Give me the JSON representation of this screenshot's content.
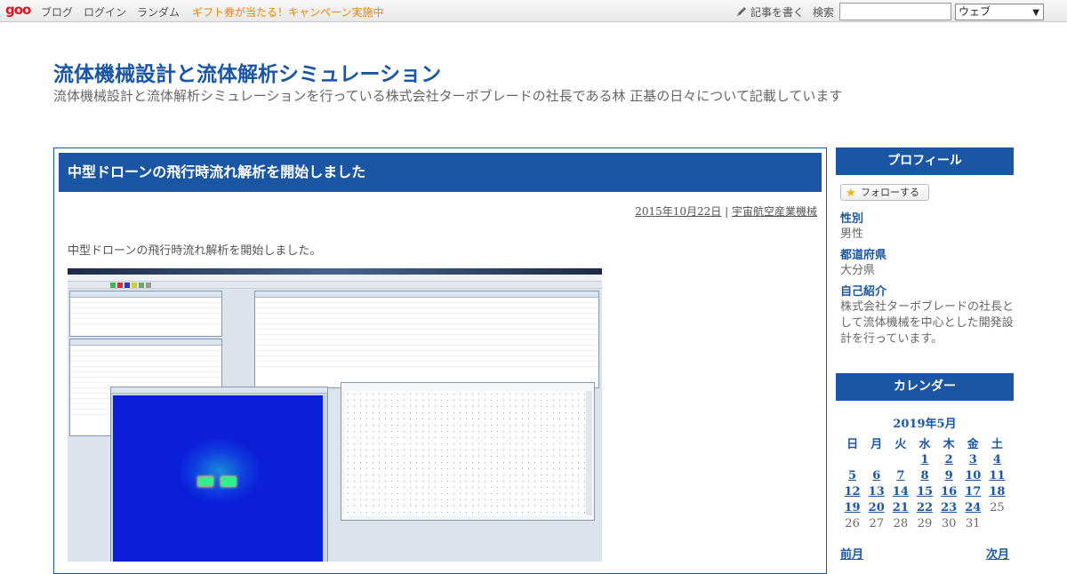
{
  "topbar": {
    "logo": "goo",
    "nav": [
      "ブログ",
      "ログイン",
      "ランダム"
    ],
    "promo": "ギフト券が当たる！キャンペーン実施中",
    "write_label": "記事を書く",
    "search_label": "検索",
    "search_value": "",
    "search_scope": "ウェブ",
    "icons": {
      "write": "pencil-icon",
      "dropdown": "chevron-down-icon"
    }
  },
  "blog": {
    "title": "流体機械設計と流体解析シミュレーション",
    "description": "流体機械設計と流体解析シミュレーションを行っている株式会社ターボブレードの社長である林 正基の日々について記載しています"
  },
  "post": {
    "title": "中型ドローンの飛行時流れ解析を開始しました",
    "date": "2015年10月22日",
    "separator": " | ",
    "category": "宇宙航空産業機械",
    "body": "中型ドローンの飛行時流れ解析を開始しました。",
    "image_alt": "analysis-software-screenshot"
  },
  "sidebar": {
    "profile": {
      "heading": "プロフィール",
      "follow_label": "フォローする",
      "fields": [
        {
          "label": "性別",
          "value": "男性"
        },
        {
          "label": "都道府県",
          "value": "大分県"
        },
        {
          "label": "自己紹介",
          "value": "株式会社ターボブレードの社長として流体機械を中心とした開発設計を行っています。"
        }
      ]
    },
    "calendar": {
      "heading": "カレンダー",
      "month": "2019年5月",
      "weekdays": [
        "日",
        "月",
        "火",
        "水",
        "木",
        "金",
        "土"
      ],
      "weeks": [
        [
          "",
          "",
          "",
          "1",
          "2",
          "3",
          "4"
        ],
        [
          "5",
          "6",
          "7",
          "8",
          "9",
          "10",
          "11"
        ],
        [
          "12",
          "13",
          "14",
          "15",
          "16",
          "17",
          "18"
        ],
        [
          "19",
          "20",
          "21",
          "22",
          "23",
          "24",
          "25"
        ],
        [
          "26",
          "27",
          "28",
          "29",
          "30",
          "31",
          ""
        ]
      ],
      "linked_days": [
        "1",
        "2",
        "3",
        "4",
        "5",
        "6",
        "7",
        "8",
        "9",
        "10",
        "11",
        "12",
        "13",
        "14",
        "15",
        "16",
        "17",
        "18",
        "19",
        "20",
        "21",
        "22",
        "23",
        "24"
      ],
      "prev_label": "前月",
      "next_label": "次月"
    }
  },
  "colors": {
    "accent": "#1b56a5",
    "promo": "#f08300",
    "logo": "#e4151c"
  }
}
